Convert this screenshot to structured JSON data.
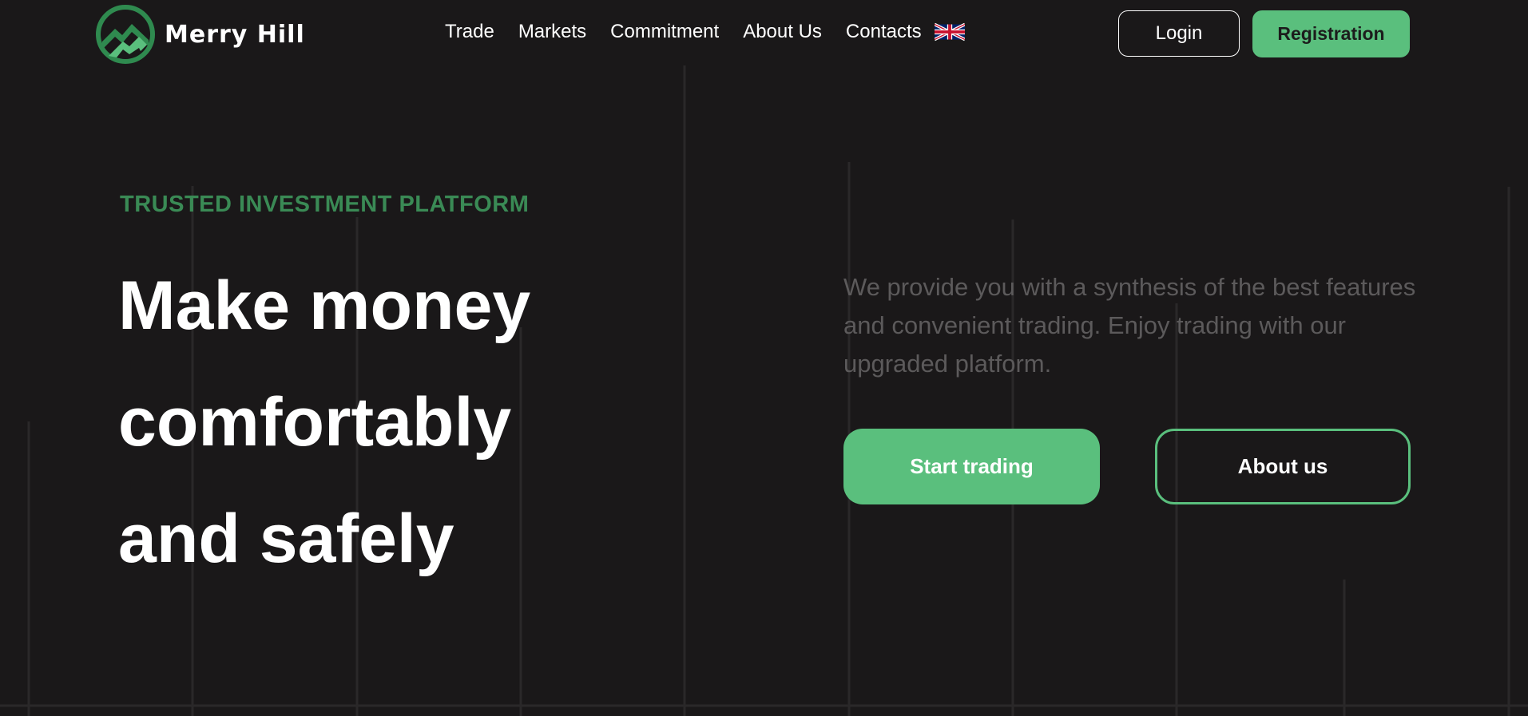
{
  "header": {
    "logo_text": "Merry Hill",
    "logo_icon": "mountain-logo-icon",
    "nav": [
      {
        "label": "Trade"
      },
      {
        "label": "Markets"
      },
      {
        "label": "Commitment"
      },
      {
        "label": "About Us"
      },
      {
        "label": "Contacts"
      }
    ],
    "language_icon": "uk-flag-icon",
    "login_label": "Login",
    "register_label": "Registration"
  },
  "hero": {
    "eyebrow": "TRUSTED INVESTMENT PLATFORM",
    "headline_lines": [
      "Make money",
      "comfortably",
      "and safely"
    ],
    "description": "We provide you with a synthesis of the best features and convenient trading. Enjoy trading with our upgraded platform.",
    "primary_button": "Start trading",
    "secondary_button": "About us"
  },
  "colors": {
    "background": "#1a1819",
    "accent": "#5abf7d",
    "eyebrow": "#3a8a55",
    "muted_text": "#5c5a5b"
  }
}
